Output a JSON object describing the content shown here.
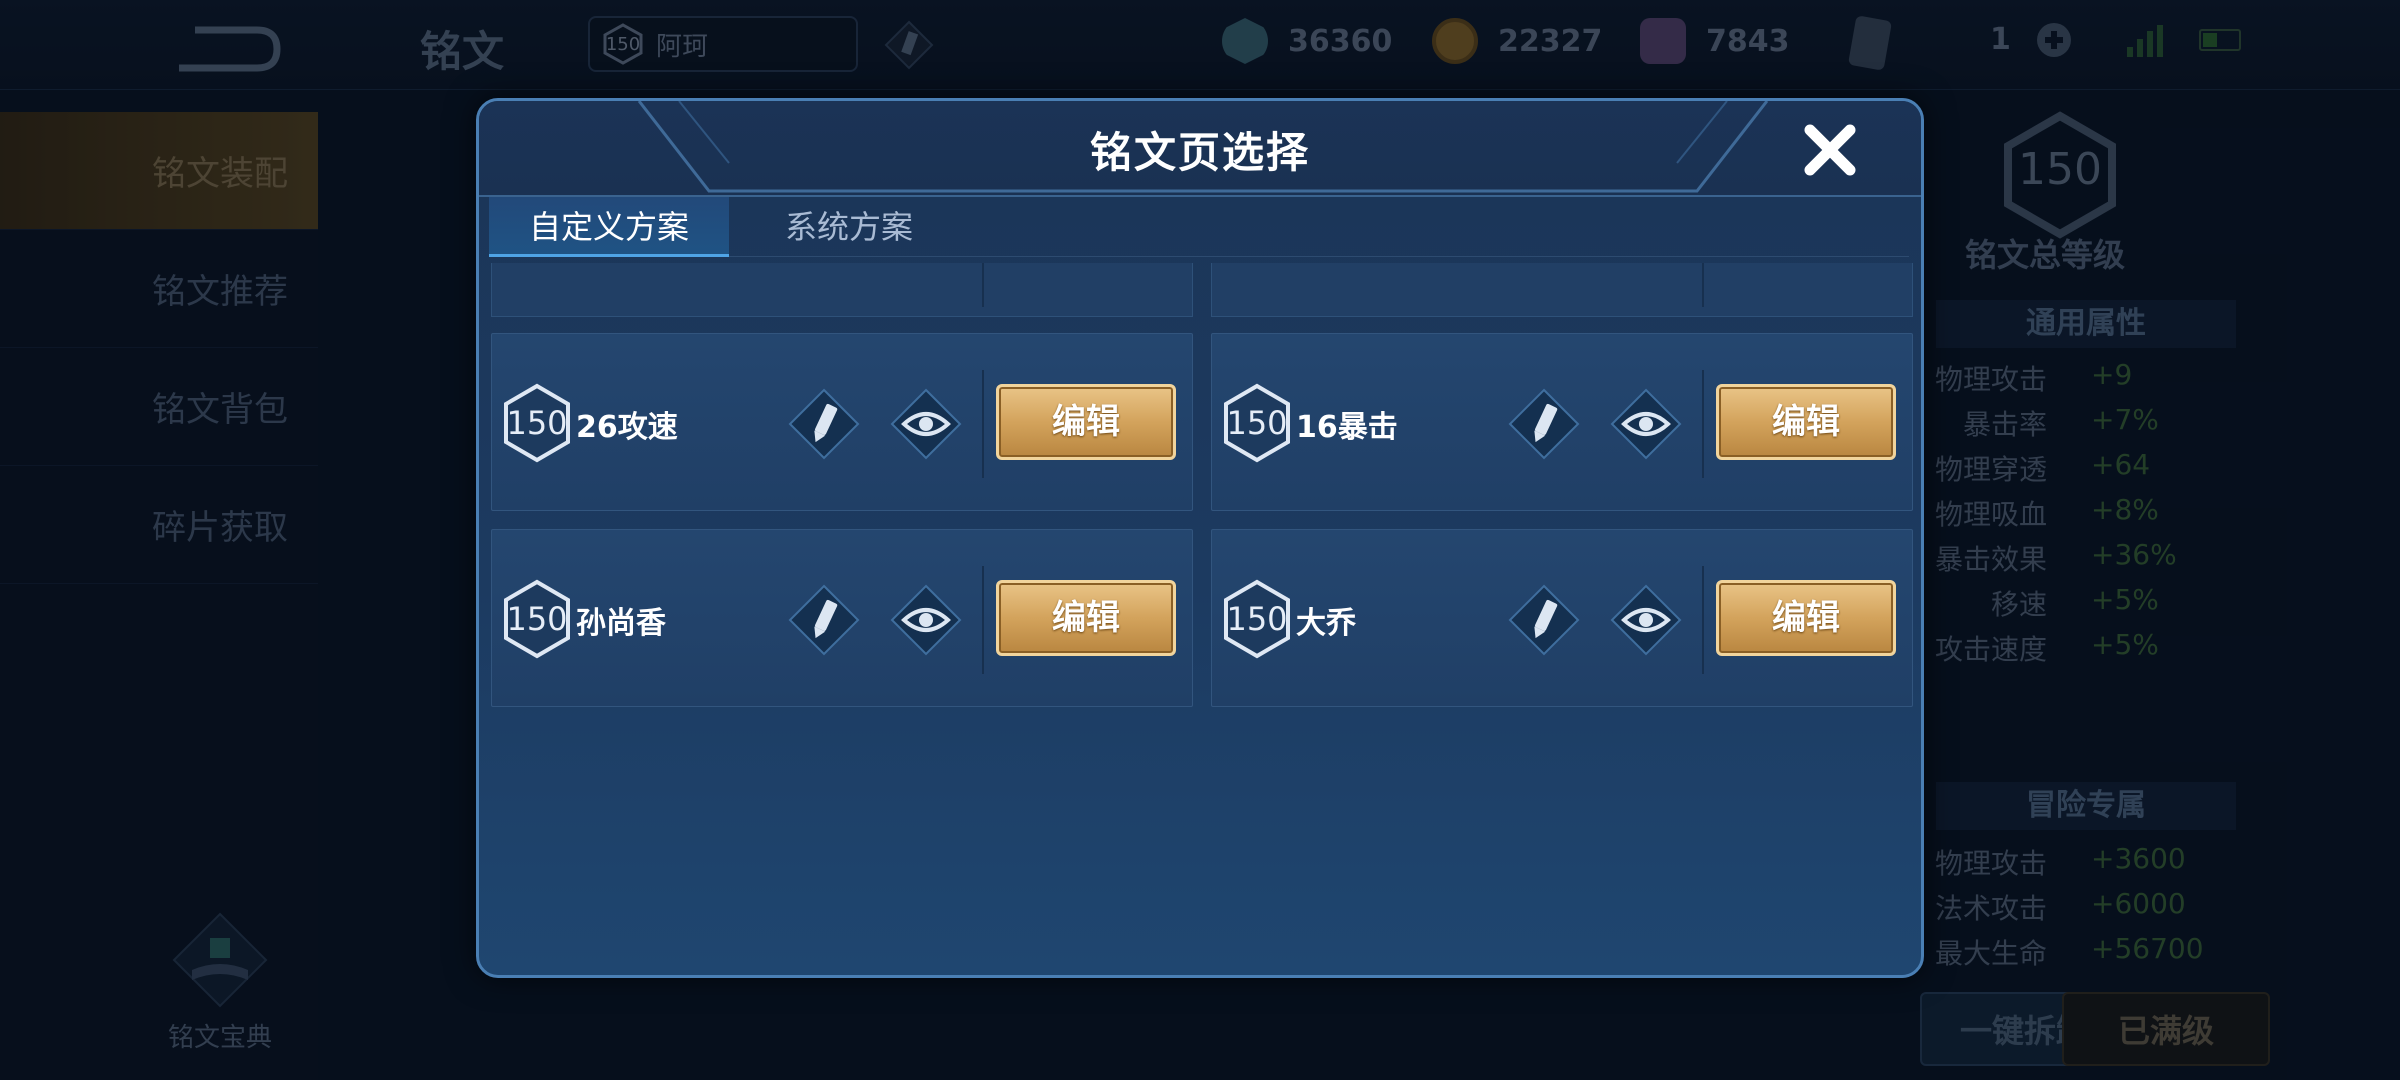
{
  "topbar": {
    "title": "铭文",
    "level_badge": "150",
    "level_name": "阿珂",
    "currencies": [
      {
        "name": "diamond-coupon",
        "amount": "36360",
        "color": "#4a7d8c"
      },
      {
        "name": "gold-coin",
        "amount": "22327",
        "color": "#a87a2c"
      },
      {
        "name": "inscription-fragment",
        "amount": "7843",
        "color": "#7c5a9a"
      }
    ],
    "card_count": "1"
  },
  "sidebar": {
    "items": [
      {
        "label": "铭文装配",
        "active": true
      },
      {
        "label": "铭文推荐",
        "active": false
      },
      {
        "label": "铭文背包",
        "active": false
      },
      {
        "label": "碎片获取",
        "active": false
      }
    ],
    "codex_label": "铭文宝典"
  },
  "right_panel": {
    "total_level": "150",
    "total_level_label": "铭文总等级",
    "general_header": "通用属性",
    "general_attrs": [
      {
        "name": "物理攻击",
        "value": "+9"
      },
      {
        "name": "暴击率",
        "value": "+7%"
      },
      {
        "name": "物理穿透",
        "value": "+64"
      },
      {
        "name": "物理吸血",
        "value": "+8%"
      },
      {
        "name": "暴击效果",
        "value": "+36%"
      },
      {
        "name": "移速",
        "value": "+5%"
      },
      {
        "name": "攻击速度",
        "value": "+5%"
      }
    ],
    "adventure_header": "冒险专属",
    "adventure_attrs": [
      {
        "name": "物理攻击",
        "value": "+3600"
      },
      {
        "name": "法术攻击",
        "value": "+6000"
      },
      {
        "name": "最大生命",
        "value": "+56700"
      }
    ],
    "unequip_all_label": "一键拆卸",
    "max_level_label": "已满级"
  },
  "modal": {
    "title": "铭文页选择",
    "tabs": [
      {
        "label": "自定义方案",
        "active": true
      },
      {
        "label": "系统方案",
        "active": false
      }
    ],
    "pages": [
      {
        "level": "150",
        "name": "26攻速",
        "edit_label": "编辑"
      },
      {
        "level": "150",
        "name": "16暴击",
        "edit_label": "编辑"
      },
      {
        "level": "150",
        "name": "孙尚香",
        "edit_label": "编辑"
      },
      {
        "level": "150",
        "name": "大乔",
        "edit_label": "编辑"
      }
    ]
  }
}
